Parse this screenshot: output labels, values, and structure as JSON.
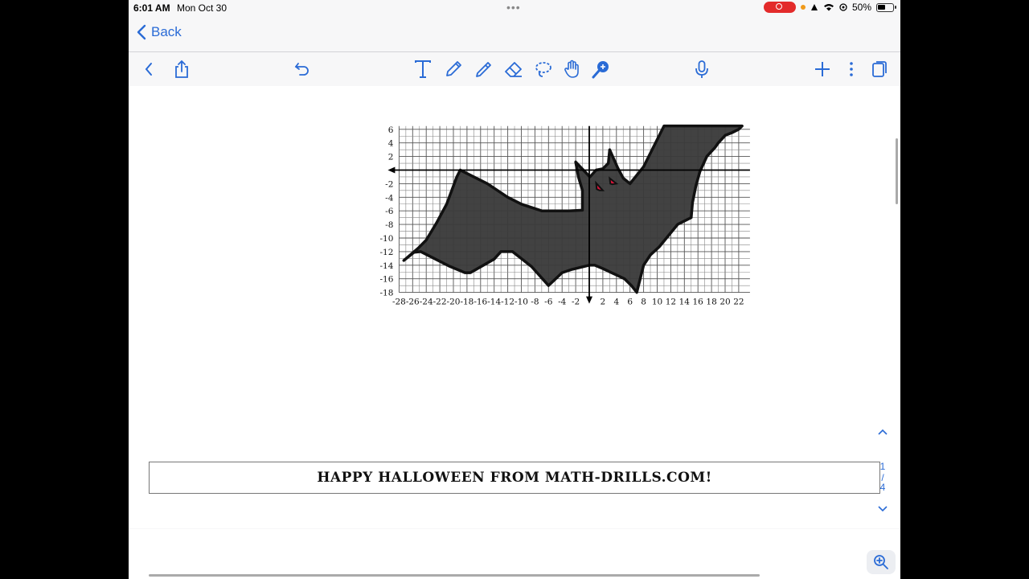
{
  "status": {
    "time": "6:01 AM",
    "date": "Mon Oct 30",
    "battery": "50%"
  },
  "nav": {
    "back_label": "Back"
  },
  "toolbar": {
    "icons": [
      "chevron-left-icon",
      "share-icon",
      "undo-icon",
      "text-tool-icon",
      "pen-icon",
      "highlighter-icon",
      "eraser-icon",
      "lasso-icon",
      "hand-icon",
      "magic-wand-icon",
      "microphone-icon",
      "plus-icon",
      "more-icon",
      "pages-icon"
    ]
  },
  "graph": {
    "x_ticks": [
      "-28",
      "-26",
      "-24",
      "-22",
      "-20",
      "-18",
      "-16",
      "-14",
      "-12",
      "-10",
      "-8",
      "-6",
      "-4",
      "-2",
      "2",
      "4",
      "6",
      "8",
      "10",
      "12",
      "14",
      "16",
      "18",
      "20",
      "22"
    ],
    "y_ticks": [
      "6",
      "4",
      "2",
      "-2",
      "-4",
      "-6",
      "-8",
      "-10",
      "-12",
      "-14",
      "-16",
      "-18"
    ],
    "shape_fill": "#3a3a3a",
    "eye_color": "#d8143a"
  },
  "banner": {
    "text": "HAPPY HALLOWEEN FROM MATH-DRILLS.COM!"
  },
  "page_indicator": {
    "current": "1",
    "separator": "/",
    "total": "4"
  },
  "colors": {
    "accent": "#2a6bd6"
  }
}
